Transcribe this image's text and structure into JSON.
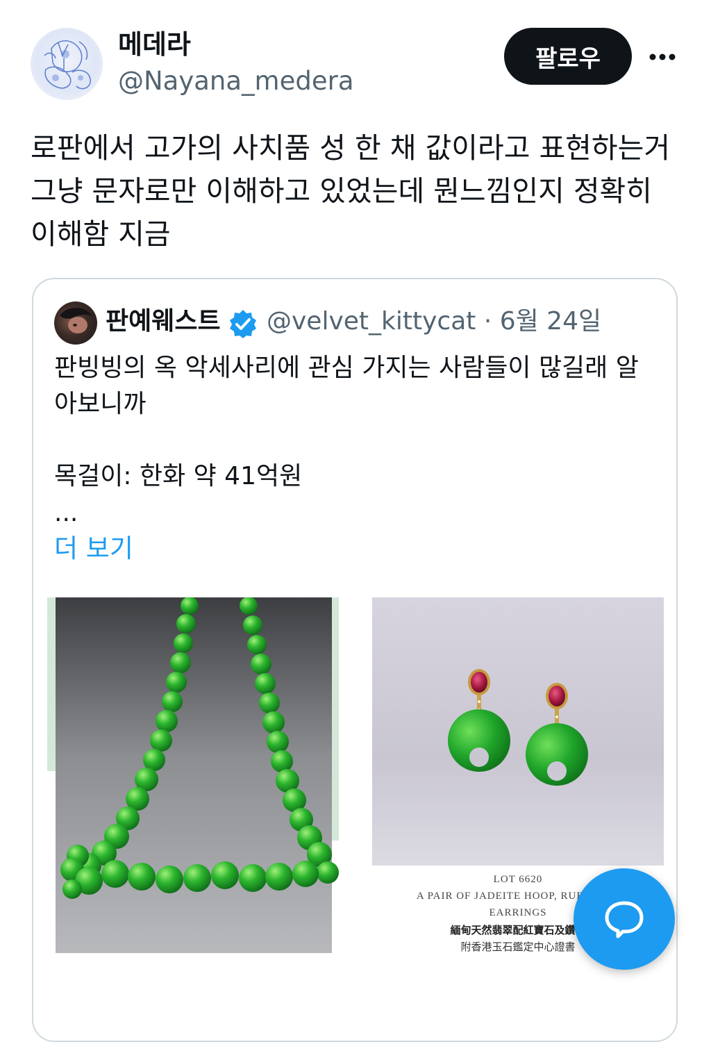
{
  "tweet": {
    "author": {
      "display_name": "메데라",
      "handle": "@Nayana_medera"
    },
    "follow_label": "팔로우",
    "text": "로판에서 고가의 사치품 성 한 채 값이라고 표현하는거\n그냥 문자로만 이해하고 있었는데 뭔느낌인지 정확히\n이해함 지금"
  },
  "quote": {
    "author": {
      "display_name": "판예웨스트",
      "handle_date": "@velvet_kittycat · 6월 24일"
    },
    "text": "판빙빙의 옥 악세사리에 관심 가지는 사람들이 많길래 알\n아보니까\n\n목걸이: 한화 약 41억원",
    "ellipsis": "...",
    "show_more": "더 보기",
    "images": {
      "right_caption": {
        "lot": "LOT 6620",
        "title_line1": "A PAIR OF JADEITE HOOP, RUBY AND",
        "title_line2": "EARRINGS",
        "zh_line1": "緬甸天然翡翠配紅寶石及鑽石",
        "zh_line2": "附香港玉石鑑定中心證書"
      }
    }
  },
  "colors": {
    "accent": "#1d9bf0",
    "text": "#0f1419",
    "secondary": "#536471",
    "border": "#cfd9de",
    "jade": "#1fa52a"
  }
}
